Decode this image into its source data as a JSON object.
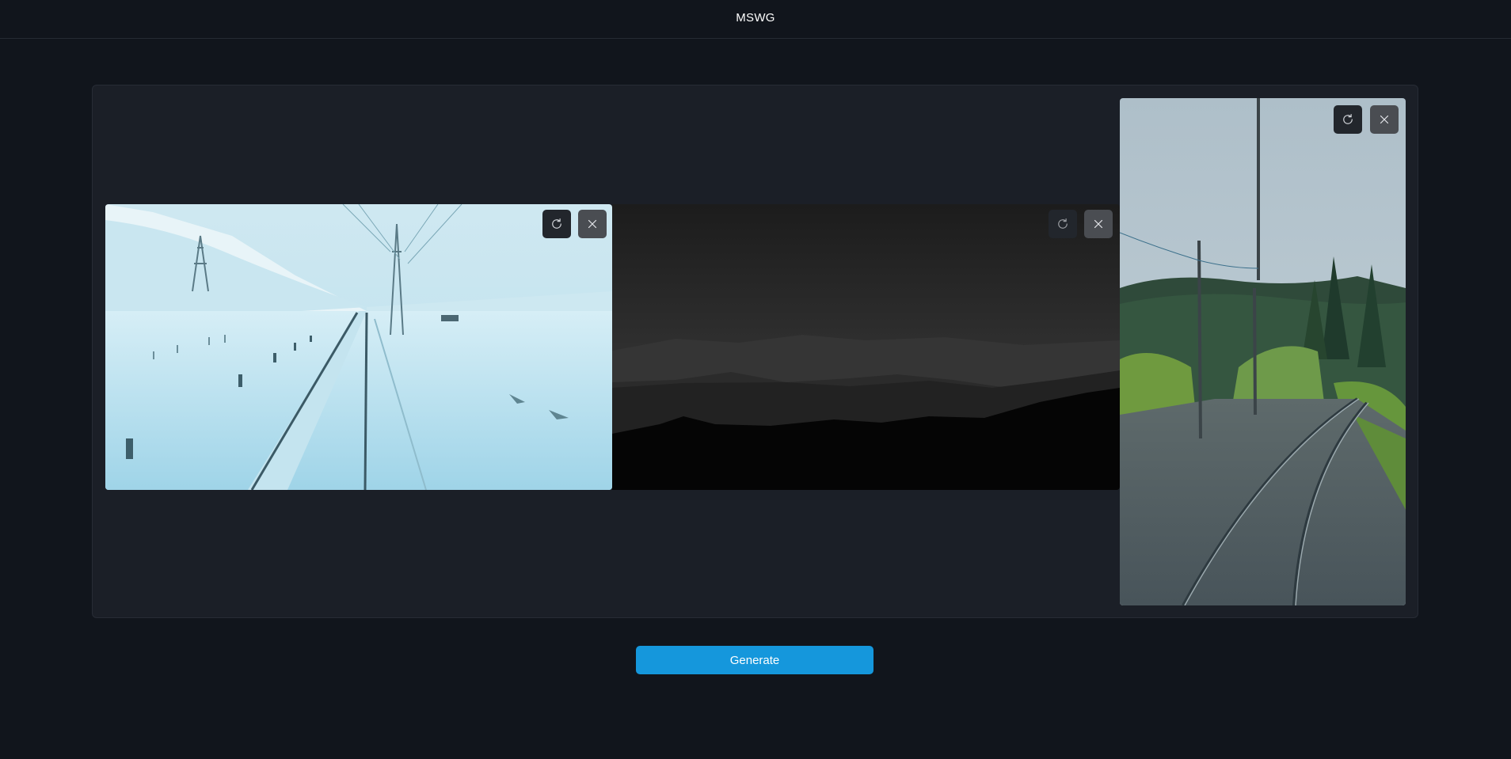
{
  "header": {
    "title": "MSWG"
  },
  "frames": [
    {
      "label": "snowy-railway",
      "refresh_icon": "refresh-icon",
      "close_icon": "close-icon"
    },
    {
      "label": "dark-mountains",
      "refresh_icon": "refresh-icon",
      "close_icon": "close-icon"
    },
    {
      "label": "forest-railway",
      "refresh_icon": "refresh-icon",
      "close_icon": "close-icon"
    }
  ],
  "actions": {
    "generate_label": "Generate"
  },
  "colors": {
    "accent": "#1597dc",
    "background": "#11151c",
    "panel": "#1b1f27"
  }
}
